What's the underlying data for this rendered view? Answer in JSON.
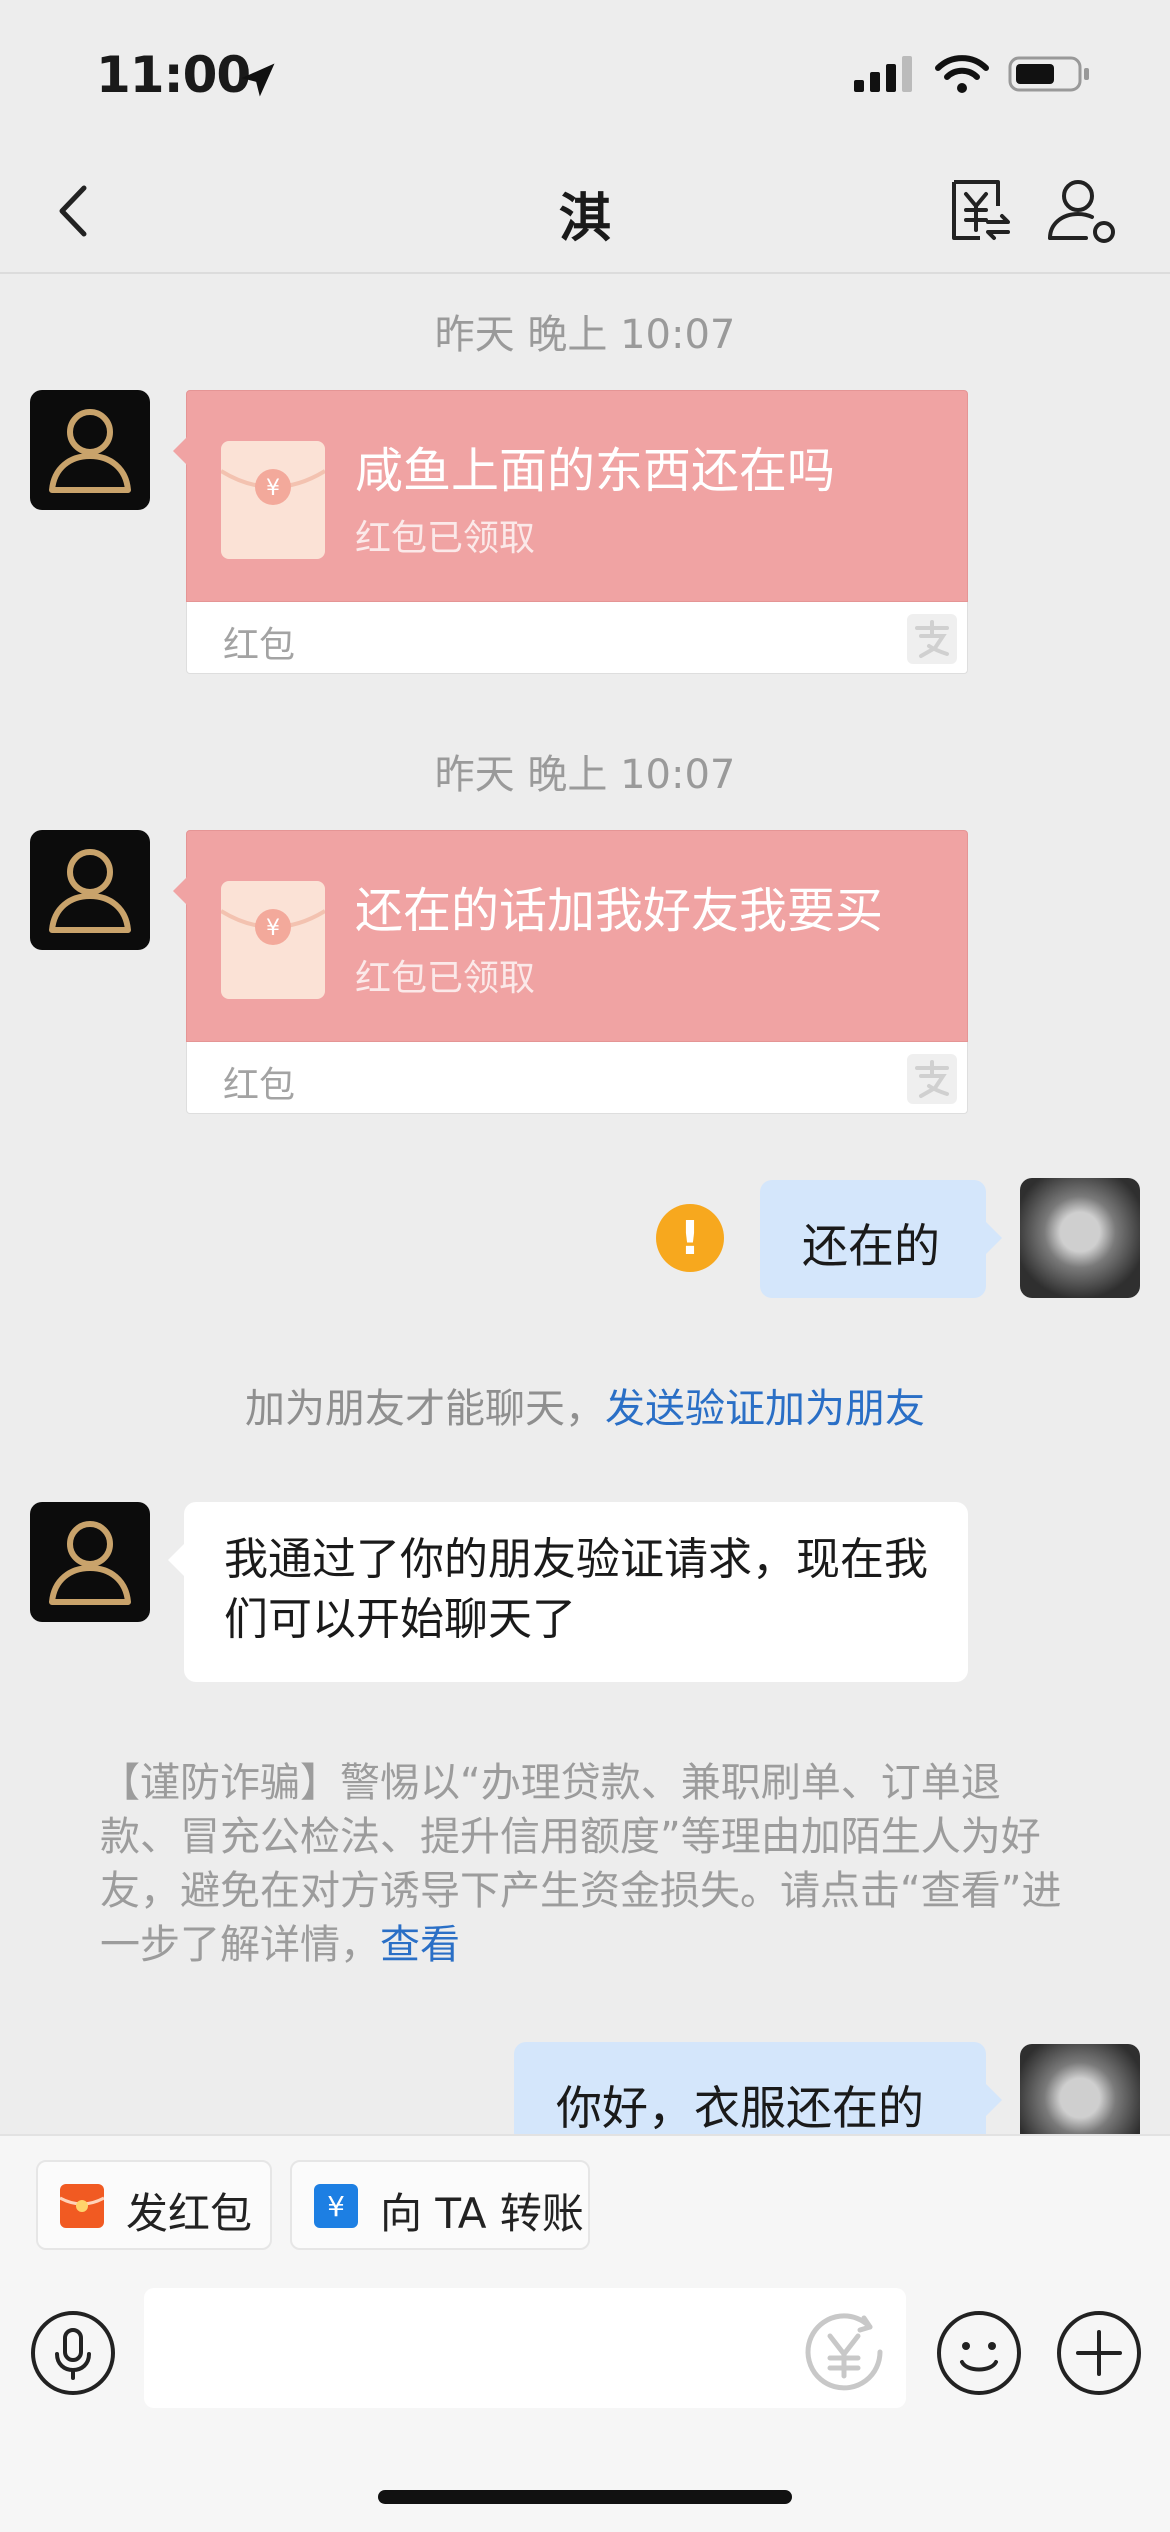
{
  "status": {
    "time": "11:00"
  },
  "header": {
    "title": "淇",
    "back_icon": "chevron-left-icon",
    "transfer_icon": "yuan-exchange-icon",
    "profile_icon": "user-settings-icon"
  },
  "messages": {
    "ts1": "昨天 晚上 10:07",
    "rp1": {
      "title": "咸鱼上面的东西还在吗",
      "status": "红包已领取",
      "label": "红包"
    },
    "ts2": "昨天 晚上 10:07",
    "rp2": {
      "title": "还在的话加我好友我要买",
      "status": "红包已领取",
      "label": "红包"
    },
    "out1": "还在的",
    "sys_prefix": "加为朋友才能聊天，",
    "sys_link": "发送验证加为朋友",
    "in1": "我通过了你的朋友验证请求，现在我们可以开始聊天了",
    "notice": "【谨防诈骗】警惕以“办理贷款、兼职刷单、订单退款、冒充公检法、提升信用额度”等理由加陌生人为好友，避免在对方诱导下产生资金损失。请点击“查看”进一步了解详情，",
    "notice_link": "查看",
    "out2": "你好，衣服还在的"
  },
  "bottom": {
    "quick1": "发红包",
    "quick2": "向 TA 转账",
    "input_value": ""
  },
  "colors": {
    "redpacket": "#f0a3a3",
    "bubble_out": "#d4e6fb",
    "link": "#2a6fc6",
    "warn": "#f7a81e"
  }
}
